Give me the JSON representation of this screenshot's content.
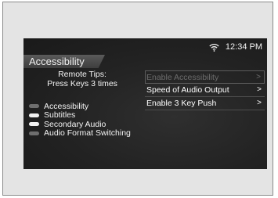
{
  "statusbar": {
    "wifi_icon": "wifi-icon",
    "time": "12:34 PM"
  },
  "screen": {
    "title": "Accessibility"
  },
  "tips": {
    "line1": "Remote Tips:",
    "line2": "Press Keys 3 times"
  },
  "status_list": [
    {
      "label": "Accessibility",
      "enabled": false
    },
    {
      "label": "Subtitles",
      "enabled": true
    },
    {
      "label": "Secondary Audio",
      "enabled": true
    },
    {
      "label": "Audio Format Switching",
      "enabled": false
    }
  ],
  "menu": [
    {
      "label": "Enable Accessibility",
      "chevron": ">",
      "disabled": true
    },
    {
      "label": "Speed of Audio Output",
      "chevron": ">",
      "disabled": false
    },
    {
      "label": "Enable 3 Key Push",
      "chevron": ">",
      "disabled": false
    }
  ],
  "colors": {
    "indicator_on": "#f2f2f2",
    "indicator_off": "#6e6e6e"
  }
}
